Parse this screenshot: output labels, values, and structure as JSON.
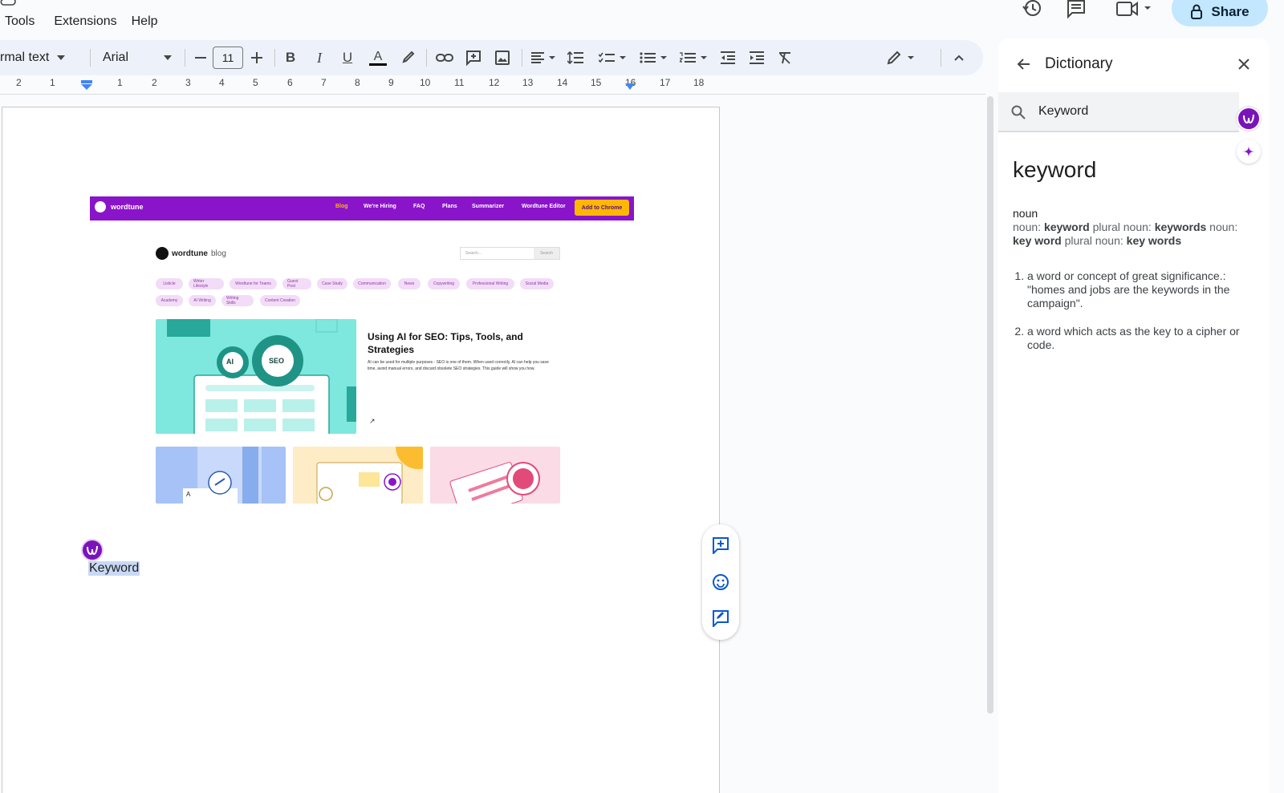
{
  "menu": {
    "items": [
      "Tools",
      "Extensions",
      "Help"
    ]
  },
  "header": {
    "share_label": "Share"
  },
  "toolbar": {
    "style_value": "rmal text",
    "font_value": "Arial",
    "font_size": "11"
  },
  "ruler": {
    "ticks": [
      "2",
      "1",
      "1",
      "2",
      "3",
      "4",
      "5",
      "6",
      "7",
      "8",
      "9",
      "10",
      "11",
      "12",
      "13",
      "14",
      "15",
      "16",
      "17",
      "18"
    ]
  },
  "embedded": {
    "brand": "wordtune",
    "nav": [
      "Blog",
      "We're Hiring",
      "FAQ",
      "Plans",
      "Summarizer",
      "Wordtune Editor"
    ],
    "cta": "Add to Chrome",
    "blog_brand": "wordtune",
    "blog_brand_suffix": "blog",
    "search_placeholder": "Search...",
    "search_button": "Search",
    "chips_row1": [
      "Listicle",
      "Writer Lifestyle",
      "Wordtune for Teams",
      "Guest Post",
      "Case Study",
      "Communication",
      "News",
      "Copywriting",
      "Professional Writing",
      "Social Media"
    ],
    "chips_row2": [
      "Academy",
      "AI Writing",
      "Writing Skills",
      "Content Creation"
    ],
    "hero_gear_left": "AI",
    "hero_gear_right": "SEO",
    "hero_title": "Using AI for SEO: Tips, Tools, and Strategies",
    "hero_body": "AI can be used for multiple purposes - SEO is one of them. When used correctly, AI can help you save time, avoid manual errors, and discard obsolete SEO strategies. This guide will show you how.",
    "hero_link": "↗",
    "card1_letter": "A"
  },
  "document": {
    "selected_word": "Keyword"
  },
  "dictionary": {
    "title": "Dictionary",
    "search_value": "Keyword",
    "headword": "keyword",
    "pos": "noun",
    "forms_prefix1": "noun: ",
    "form1": "keyword",
    "forms_mid1": " plural noun: ",
    "form2": "keywords",
    "forms_mid2": " noun: ",
    "form3": "key word",
    "forms_mid3": " plural noun: ",
    "form4": "key words",
    "definitions": [
      "a word or concept of great significance.: \"homes and jobs are the keywords in the campaign\".",
      "a word which acts as the key to a cipher or code."
    ]
  }
}
